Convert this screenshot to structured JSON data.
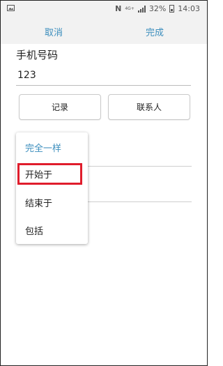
{
  "status_bar": {
    "network": "4G+",
    "battery": "32%",
    "time": "14:03"
  },
  "action_bar": {
    "cancel_label": "取消",
    "done_label": "完成"
  },
  "form": {
    "title": "手机号码",
    "phone_value": "123",
    "record_button": "记录",
    "contacts_button": "联系人"
  },
  "dropdown": {
    "items": [
      {
        "label": "完全一样",
        "selected": true
      },
      {
        "label": "开始于",
        "selected": false
      },
      {
        "label": "结束于",
        "selected": false
      },
      {
        "label": "包括",
        "selected": false
      }
    ],
    "highlighted_item": "开始于",
    "highlight_color": "#e01d2c"
  },
  "colors": {
    "accent": "#3c8ebd",
    "bar_background": "#f2f2f2"
  }
}
